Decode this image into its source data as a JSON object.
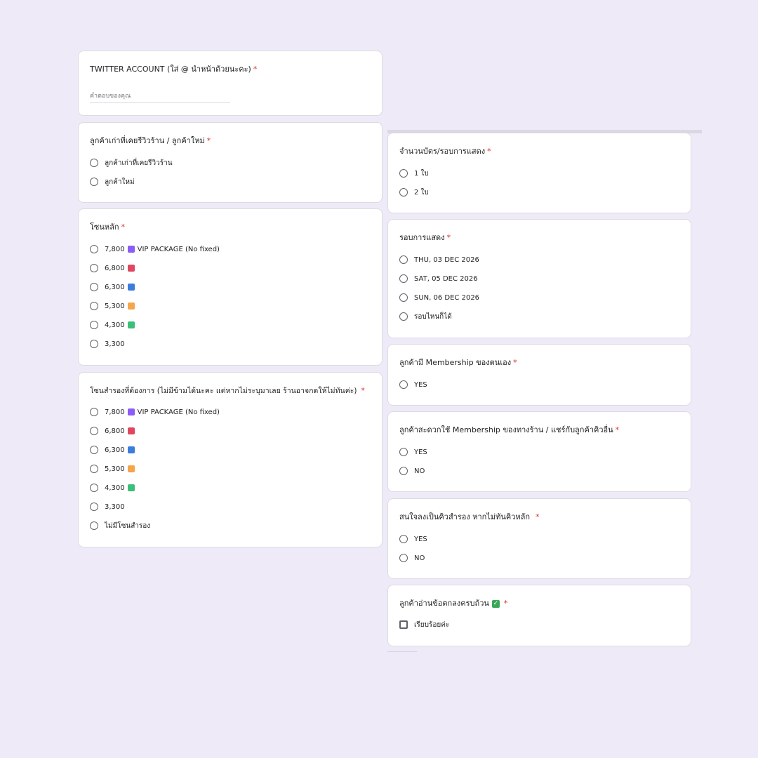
{
  "colors": {
    "background": "#efeaf8",
    "required": "#d93025",
    "swatch_purple": "#8b5cf6",
    "swatch_red": "#e0475f",
    "swatch_blue": "#3b7ddd",
    "swatch_orange": "#f5a54a",
    "swatch_green": "#3bbf7a"
  },
  "left": {
    "twitter": {
      "title": "TWITTER ACCOUNT (ใส่ @ นำหน้าด้วยนะคะ)",
      "required": "*",
      "placeholder": "คำตอบของคุณ"
    },
    "customer_type": {
      "title": "ลูกค้าเก่าที่เคยรีวิวร้าน / ลูกค้าใหม่",
      "required": "*",
      "options": [
        "ลูกค้าเก่าที่เคยรีวิวร้าน",
        "ลูกค้าใหม่"
      ]
    },
    "main_zone": {
      "title": "โซนหลัก",
      "required": "*",
      "options": [
        "7,800",
        "6,800",
        "6,300",
        "5,300",
        "4,300",
        "3,300"
      ],
      "vip_label": "VIP PACKAGE (No fixed)"
    },
    "backup_zone": {
      "title": "โซนสำรองที่ต้องการ (ไม่มีข้ามได้นะคะ แต่หากไม่ระบุมาเลย ร้านอาจกดให้ไม่ทันค่ะ)",
      "required": "*",
      "options": [
        "7,800",
        "6,800",
        "6,300",
        "5,300",
        "4,300",
        "3,300",
        "ไม่มีโซนสำรอง"
      ],
      "vip_label": "VIP PACKAGE (No fixed)"
    }
  },
  "right": {
    "ticket_count": {
      "title": "จำนวนบัตร/รอบการแสดง",
      "required": "*",
      "options": [
        "1 ใบ",
        "2 ใบ"
      ]
    },
    "show_round": {
      "title": "รอบการแสดง",
      "required": "*",
      "options": [
        "THU, 03 DEC 2026",
        "SAT, 05 DEC 2026",
        "SUN, 06 DEC 2026",
        "รอบไหนก็ได้"
      ]
    },
    "own_membership": {
      "title": "ลูกค้ามี Membership ของตนเอง",
      "required": "*",
      "options": [
        "YES"
      ]
    },
    "shop_membership": {
      "title": "ลูกค้าสะดวกใช้ Membership ของทางร้าน / แชร์กับลูกค้าคิวอื่น",
      "required": "*",
      "options": [
        "YES",
        "NO"
      ]
    },
    "waitlist": {
      "title": "สนใจลงเป็นคิวสำรอง หากไม่ทันคิวหลัก",
      "required": "*",
      "options": [
        "YES",
        "NO"
      ]
    },
    "agreement": {
      "title": "ลูกค้าอ่านข้อตกลงครบถ้วน",
      "check_glyph": "✓",
      "required": "*",
      "options": [
        "เรียบร้อยค่ะ"
      ]
    }
  }
}
